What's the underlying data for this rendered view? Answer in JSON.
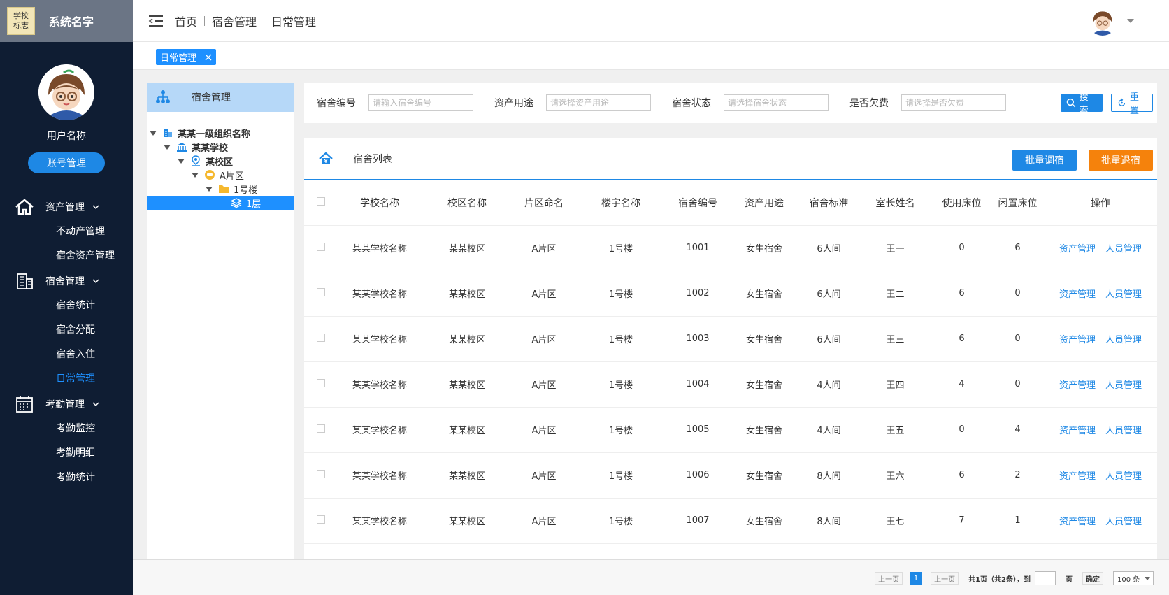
{
  "brand": {
    "logo_line1": "学校",
    "logo_line2": "标志",
    "system_name": "系统名字"
  },
  "user": {
    "name": "用户名称",
    "account_button": "账号管理"
  },
  "sidebar": {
    "groups": [
      {
        "title": "资产管理",
        "icon": "home-icon",
        "items": [
          "不动产管理",
          "宿舍资产管理"
        ]
      },
      {
        "title": "宿舍管理",
        "icon": "building-icon",
        "items": [
          "宿舍统计",
          "宿舍分配",
          "宿舍入住",
          "日常管理"
        ]
      },
      {
        "title": "考勤管理",
        "icon": "calendar-icon",
        "items": [
          "考勤监控",
          "考勤明细",
          "考勤统计"
        ]
      }
    ],
    "active_item": "日常管理"
  },
  "breadcrumb": [
    "首页",
    "宿舍管理",
    "日常管理"
  ],
  "tabs": [
    {
      "label": "日常管理"
    }
  ],
  "tree": {
    "header": "宿舍管理",
    "nodes": [
      {
        "label": "某某一级组织名称",
        "level": 0,
        "icon": "org-icon"
      },
      {
        "label": "某某学校",
        "level": 1,
        "icon": "school-icon"
      },
      {
        "label": "某校区",
        "level": 2,
        "icon": "location-icon"
      },
      {
        "label": "A片区",
        "level": 3,
        "icon": "area-icon"
      },
      {
        "label": "1号楼",
        "level": 4,
        "icon": "folder-icon"
      },
      {
        "label": "1层",
        "level": 5,
        "icon": "layers-icon",
        "selected": true
      }
    ]
  },
  "search": {
    "fields": [
      {
        "label": "宿舍编号",
        "placeholder": "请输入宿舍编号"
      },
      {
        "label": "资产用途",
        "placeholder": "请选择资产用途"
      },
      {
        "label": "宿舍状态",
        "placeholder": "请选择宿舍状态"
      },
      {
        "label": "是否欠费",
        "placeholder": "请选择是否欠费"
      }
    ],
    "search_button": "搜索",
    "reset_button": "重置"
  },
  "list": {
    "title": "宿舍列表",
    "batch_transfer": "批量调宿",
    "batch_checkout": "批量退宿",
    "columns": [
      "学校名称",
      "校区名称",
      "片区命名",
      "楼宇名称",
      "宿舍编号",
      "资产用途",
      "宿舍标准",
      "室长姓名",
      "使用床位",
      "闲置床位",
      "操作"
    ],
    "op_asset": "资产管理",
    "op_people": "人员管理",
    "rows": [
      [
        "某某学校名称",
        "某某校区",
        "A片区",
        "1号楼",
        "1001",
        "女生宿舍",
        "6人间",
        "王一",
        "0",
        "6"
      ],
      [
        "某某学校名称",
        "某某校区",
        "A片区",
        "1号楼",
        "1002",
        "女生宿舍",
        "6人间",
        "王二",
        "6",
        "0"
      ],
      [
        "某某学校名称",
        "某某校区",
        "A片区",
        "1号楼",
        "1003",
        "女生宿舍",
        "6人间",
        "王三",
        "6",
        "0"
      ],
      [
        "某某学校名称",
        "某某校区",
        "A片区",
        "1号楼",
        "1004",
        "女生宿舍",
        "4人间",
        "王四",
        "4",
        "0"
      ],
      [
        "某某学校名称",
        "某某校区",
        "A片区",
        "1号楼",
        "1005",
        "女生宿舍",
        "4人间",
        "王五",
        "0",
        "4"
      ],
      [
        "某某学校名称",
        "某某校区",
        "A片区",
        "1号楼",
        "1006",
        "女生宿舍",
        "8人间",
        "王六",
        "6",
        "2"
      ],
      [
        "某某学校名称",
        "某某校区",
        "A片区",
        "1号楼",
        "1007",
        "女生宿舍",
        "8人间",
        "王七",
        "7",
        "1"
      ]
    ]
  },
  "pagination": {
    "prev": "上一页",
    "current": "1",
    "next": "上一页",
    "summary": "共1页（共2条），到",
    "page_unit": "页",
    "confirm": "确定",
    "page_size": "100 条"
  },
  "colors": {
    "sidebar_bg": "#0f1d33",
    "primary": "#1e88e5",
    "orange": "#f5820c",
    "tree_header": "#b6d8f8"
  }
}
